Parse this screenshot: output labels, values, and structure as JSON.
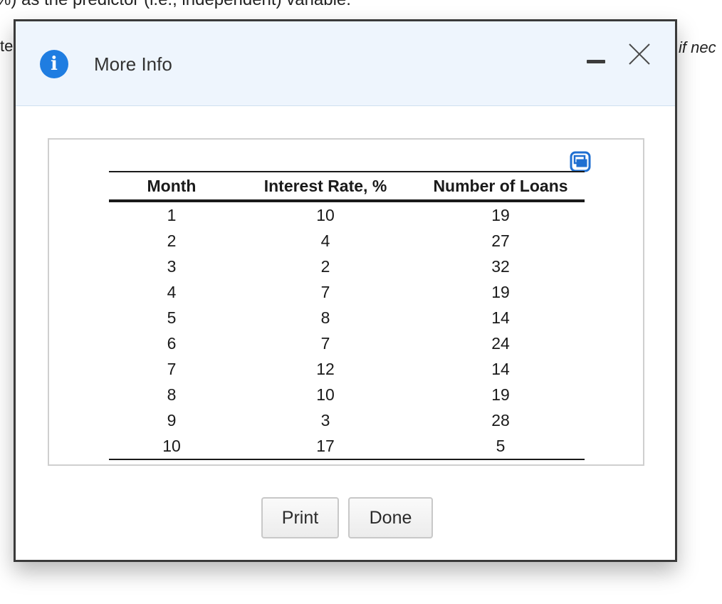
{
  "background": {
    "top_text": "%) as the predictor (i.e., independent) variable.",
    "left_text": "te",
    "right_text": "if nec"
  },
  "dialog": {
    "title": "More Info",
    "info_icon": "info-icon",
    "minimize_icon": "minimize-icon",
    "close_icon": "close-icon",
    "copy_icon": "copy-icon",
    "accent_color": "#1f7de1",
    "header_bg": "#eef5fd"
  },
  "table": {
    "headers": [
      "Month",
      "Interest Rate, %",
      "Number of Loans"
    ],
    "rows": [
      [
        "1",
        "10",
        "19"
      ],
      [
        "2",
        "4",
        "27"
      ],
      [
        "3",
        "2",
        "32"
      ],
      [
        "4",
        "7",
        "19"
      ],
      [
        "5",
        "8",
        "14"
      ],
      [
        "6",
        "7",
        "24"
      ],
      [
        "7",
        "12",
        "14"
      ],
      [
        "8",
        "10",
        "19"
      ],
      [
        "9",
        "3",
        "28"
      ],
      [
        "10",
        "17",
        "5"
      ]
    ]
  },
  "buttons": {
    "print_label": "Print",
    "done_label": "Done"
  }
}
